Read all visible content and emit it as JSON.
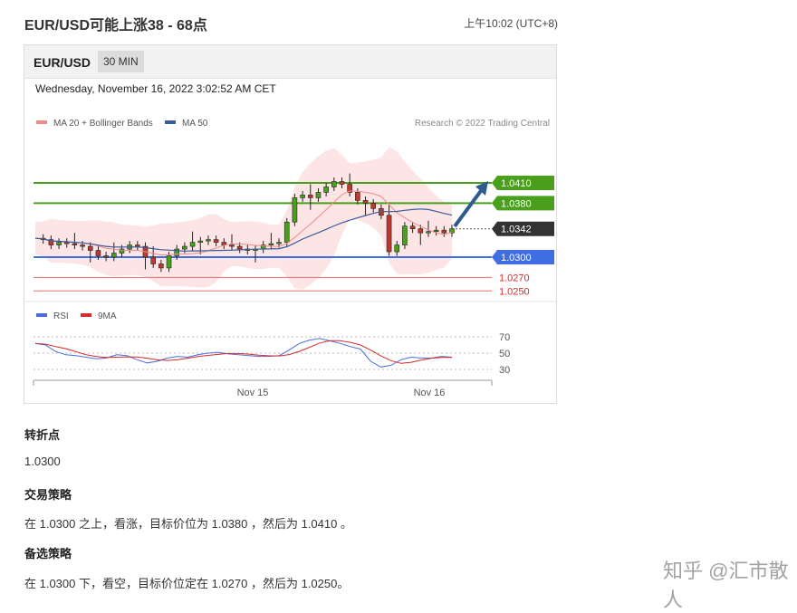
{
  "header": {
    "title": "EUR/USD可能上涨38 - 68点",
    "time": "上午10:02 (UTC+8)"
  },
  "chart_panel": {
    "symbol": "EUR/USD",
    "timeframe": "30 MIN",
    "date": "Wednesday, November 16, 2022 3:02:52 AM CET",
    "legend": {
      "ma20": "MA 20 + Bollinger Bands",
      "ma50": "MA 50",
      "research": "Research © 2022 Trading Central",
      "rsi": "RSI",
      "ma9": "9MA"
    },
    "colors": {
      "green": "#4aa01c",
      "blue": "#3f6ee0",
      "red": "#d62b2b",
      "dark": "#333333",
      "bollinger": "#fde0e0",
      "ma50": "#3b5b9a"
    }
  },
  "chart_data": {
    "type": "line",
    "price_levels": [
      {
        "label": "1.0410",
        "value": 1.041,
        "kind": "target"
      },
      {
        "label": "1.0380",
        "value": 1.038,
        "kind": "target"
      },
      {
        "label": "1.0342",
        "value": 1.0342,
        "kind": "current"
      },
      {
        "label": "1.0300",
        "value": 1.03,
        "kind": "pivot"
      },
      {
        "label": "1.0270",
        "value": 1.027,
        "kind": "support"
      },
      {
        "label": "1.0250",
        "value": 1.025,
        "kind": "support"
      }
    ],
    "x_ticks": [
      "Nov 15",
      "Nov 16"
    ],
    "rsi_ticks": [
      "70",
      "50",
      "30"
    ],
    "price_series": [
      1.0328,
      1.0326,
      1.0318,
      1.0322,
      1.032,
      1.0318,
      1.0316,
      1.031,
      1.0302,
      1.03,
      1.0306,
      1.0312,
      1.0318,
      1.0316,
      1.03,
      1.029,
      1.0284,
      1.0302,
      1.0312,
      1.0316,
      1.0322,
      1.0324,
      1.0326,
      1.0322,
      1.0318,
      1.0316,
      1.0312,
      1.031,
      1.0312,
      1.0318,
      1.032,
      1.0322,
      1.0352,
      1.0388,
      1.0392,
      1.0388,
      1.0396,
      1.0404,
      1.0412,
      1.0408,
      1.0396,
      1.0384,
      1.038,
      1.0372,
      1.0362,
      1.0308,
      1.0318,
      1.0346,
      1.0342,
      1.0336,
      1.0338,
      1.034,
      1.0336,
      1.0342
    ],
    "rsi_series": [
      62,
      60,
      52,
      48,
      47,
      45,
      43,
      44,
      48,
      47,
      42,
      38,
      40,
      44,
      46,
      45,
      48,
      50,
      51,
      49,
      48,
      47,
      46,
      46,
      47,
      54,
      62,
      66,
      68,
      65,
      62,
      58,
      55,
      40,
      33,
      35,
      42,
      45,
      44,
      44,
      46,
      45
    ]
  },
  "sections": [
    {
      "heading": "转折点",
      "text": "1.0300"
    },
    {
      "heading": "交易策略",
      "text": "在 1.0300 之上，看涨，目标价位为 1.0380 ，然后为 1.0410 。"
    },
    {
      "heading": "备选策略",
      "text": "在 1.0300 下，看空，目标价位定在 1.0270 ，然后为 1.0250。"
    }
  ],
  "watermark": "知乎 @汇市散人"
}
